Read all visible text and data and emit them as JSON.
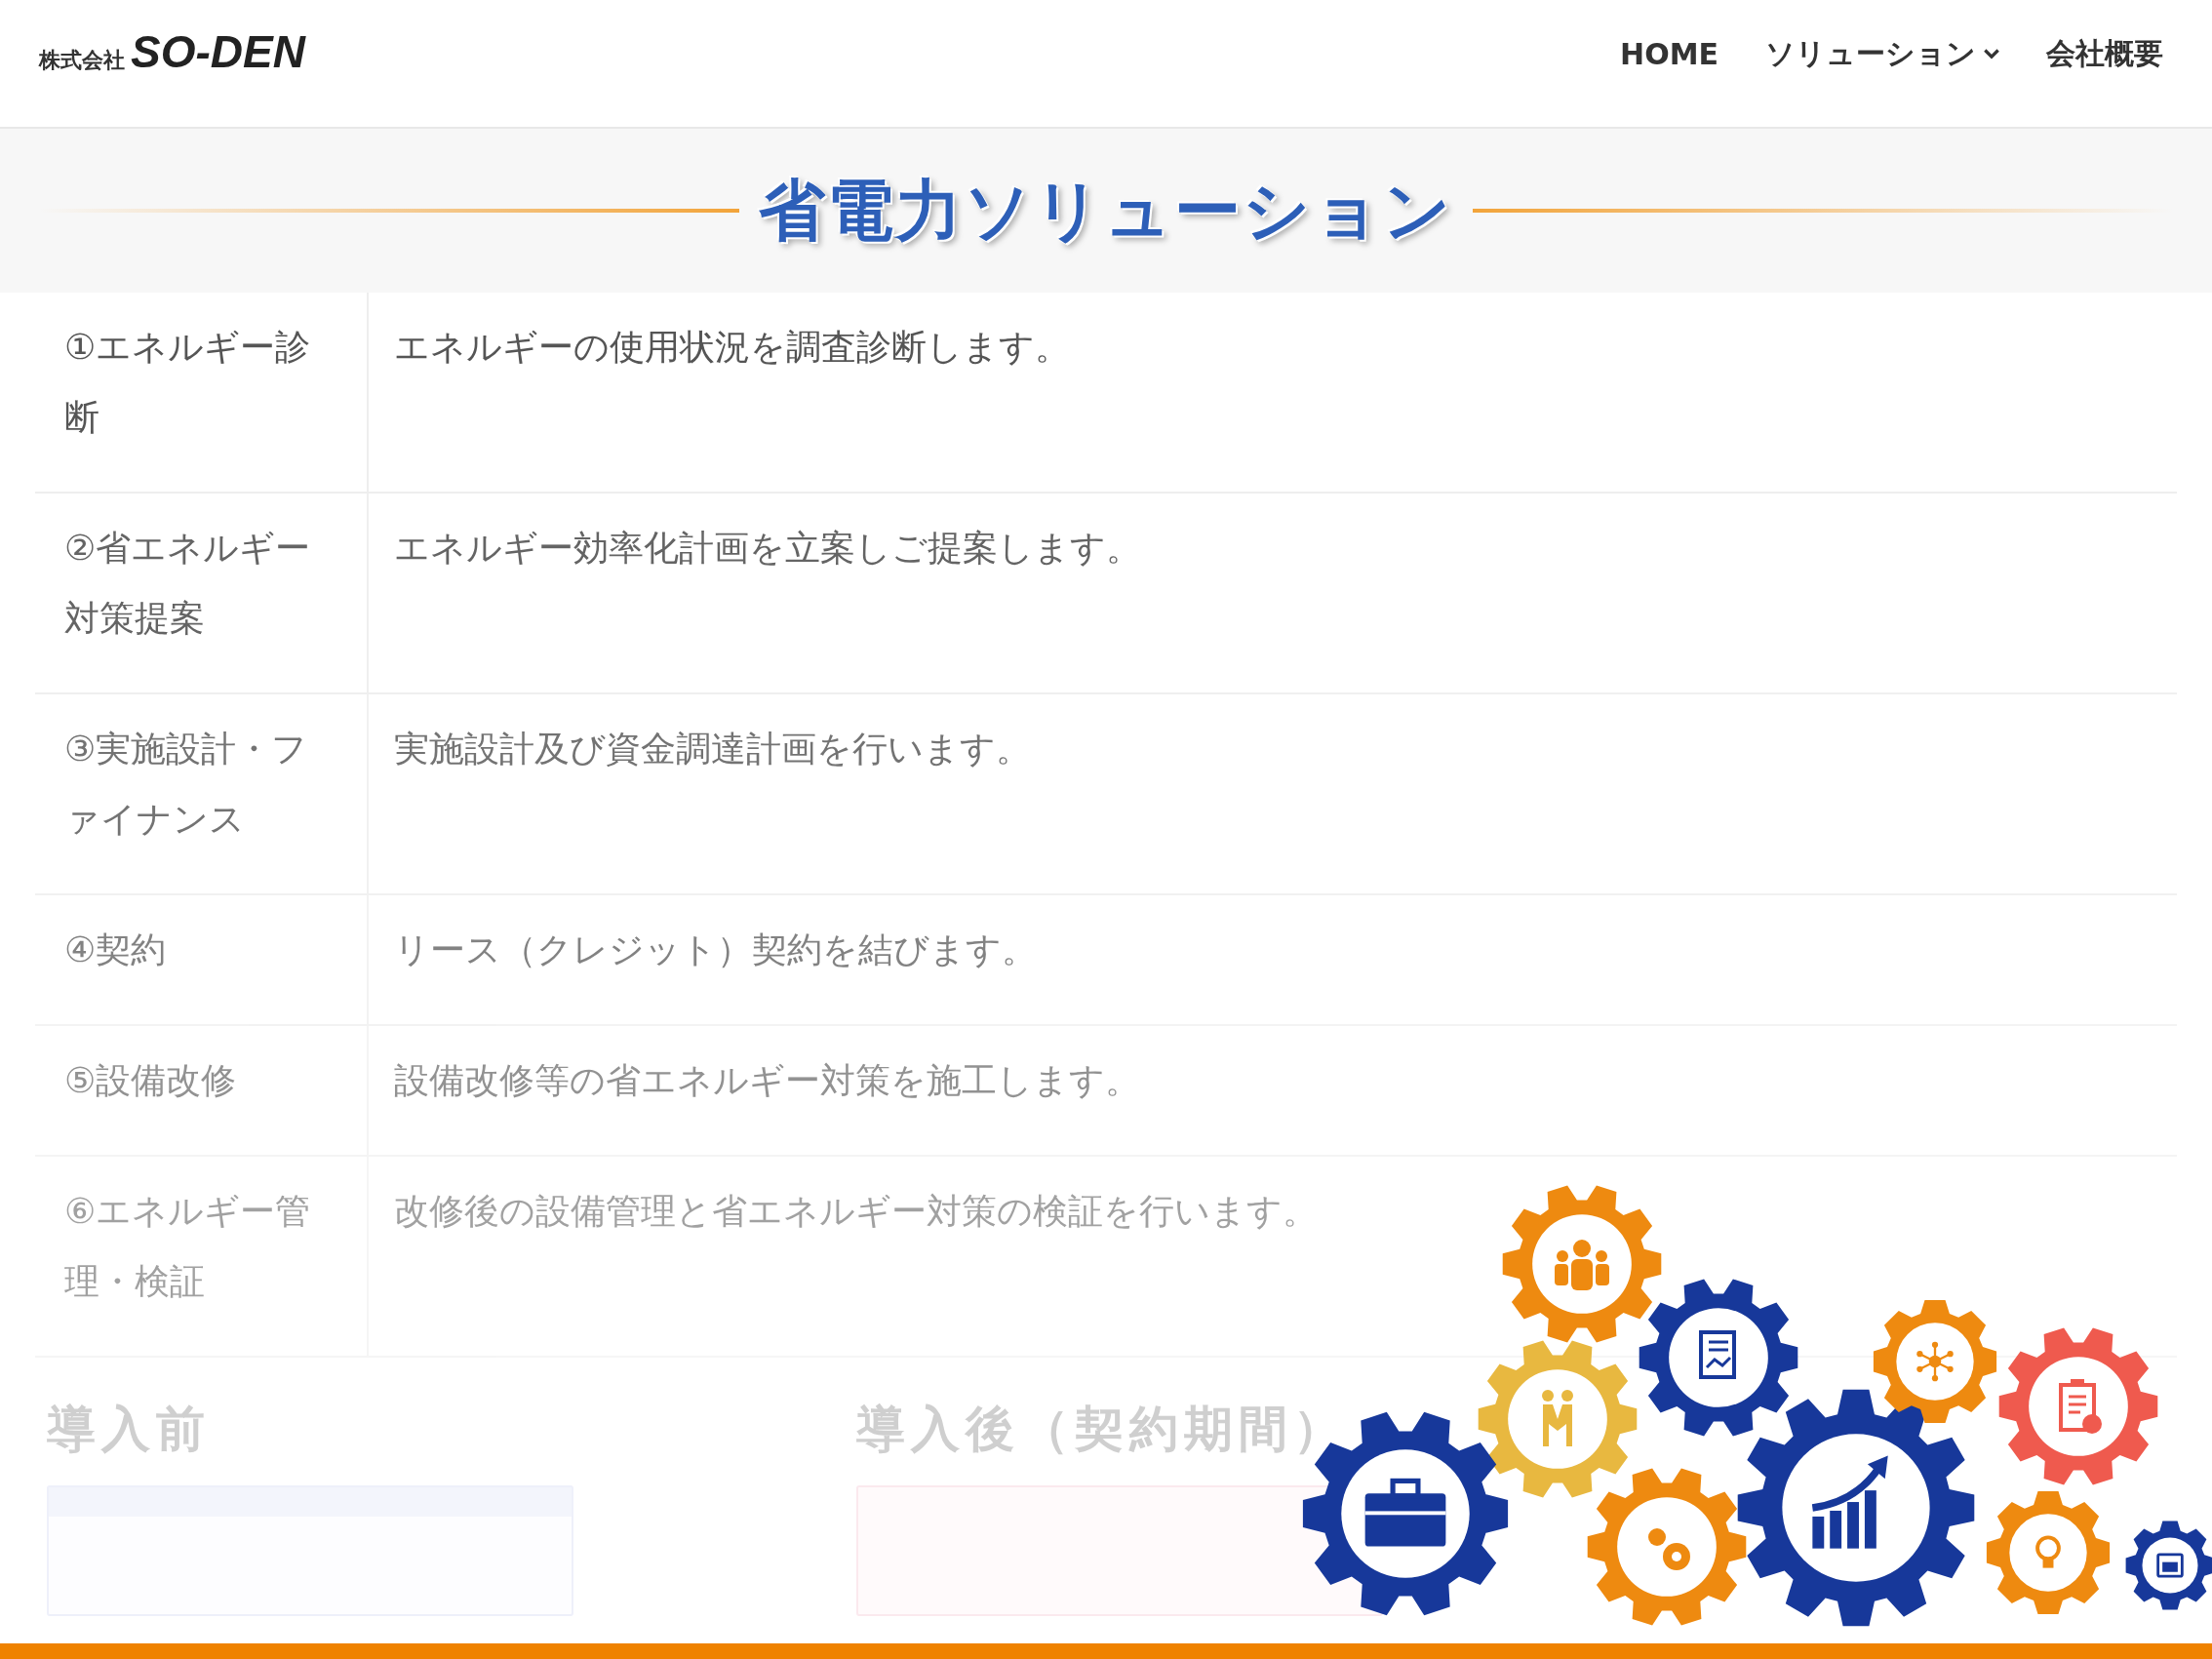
{
  "header": {
    "logo": {
      "prefix": "株式会社",
      "name": "SO-DEN"
    },
    "nav": [
      {
        "label": "HOME",
        "has_dropdown": false
      },
      {
        "label": "ソリューション",
        "has_dropdown": true
      },
      {
        "label": "会社概要",
        "has_dropdown": false
      }
    ]
  },
  "banner": {
    "title": "省電力ソリューション"
  },
  "steps": [
    {
      "step": "①エネルギー診断",
      "description": "エネルギーの使用状況を調査診断します。"
    },
    {
      "step": "②省エネルギー対策提案",
      "description": "エネルギー効率化計画を立案しご提案します。"
    },
    {
      "step": "③実施設計・ファイナンス",
      "description": "実施設計及び資金調達計画を行います。"
    },
    {
      "step": "④契約",
      "description": "リース（クレジット）契約を結びます。"
    },
    {
      "step": "⑤設備改修",
      "description": "設備改修等の省エネルギー対策を施工します。"
    },
    {
      "step": "⑥エネルギー管理・検証",
      "description": "改修後の設備管理と省エネルギー対策の検証を行います。"
    }
  ],
  "comparison": [
    {
      "heading": "導入前"
    },
    {
      "heading": "導入後（契約期間）"
    }
  ]
}
